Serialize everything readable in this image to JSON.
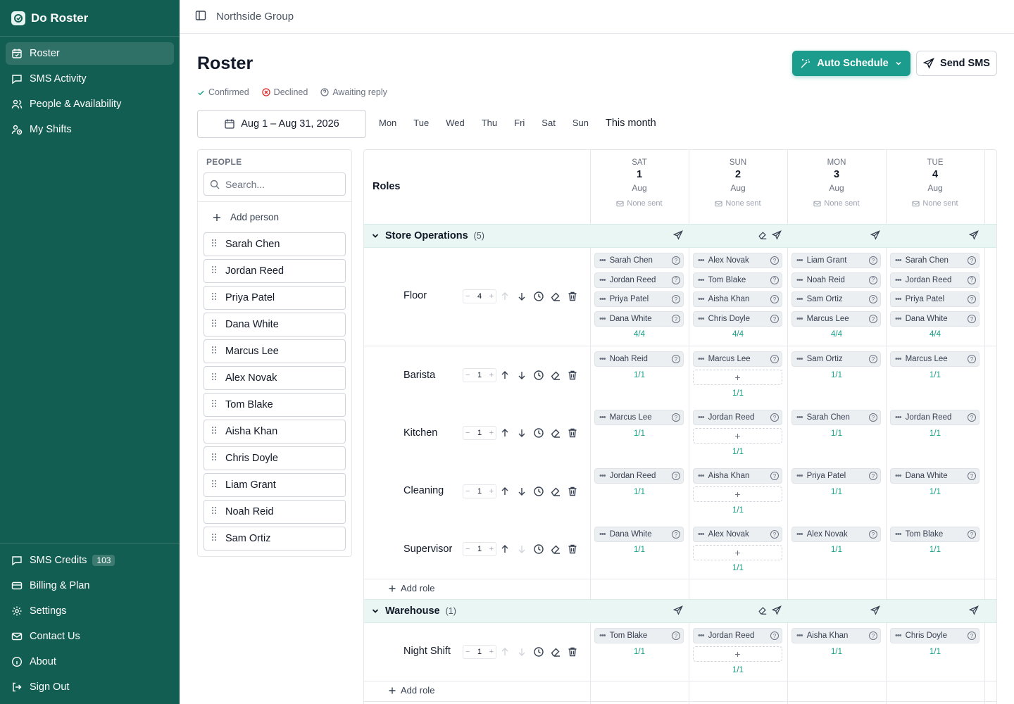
{
  "app": {
    "title": "Do Roster",
    "org": "Northside Group"
  },
  "sidebar": {
    "items": [
      {
        "label": "Roster",
        "icon": "calendar-check-icon",
        "active": true
      },
      {
        "label": "SMS Activity",
        "icon": "message-square-icon"
      },
      {
        "label": "People & Availability",
        "icon": "users-icon"
      },
      {
        "label": "My Shifts",
        "icon": "user-clock-icon"
      }
    ],
    "bottom": [
      {
        "label": "SMS Credits",
        "icon": "message-square-icon",
        "badge": "103"
      },
      {
        "label": "Billing & Plan",
        "icon": "credit-card-icon"
      },
      {
        "label": "Settings",
        "icon": "gear-icon"
      },
      {
        "label": "Contact Us",
        "icon": "mail-icon"
      },
      {
        "label": "About",
        "icon": "info-icon"
      },
      {
        "label": "Sign Out",
        "icon": "log-out-icon"
      }
    ]
  },
  "page": {
    "title": "Roster"
  },
  "legend": {
    "confirmed": "Confirmed",
    "declined": "Declined",
    "awaiting": "Awaiting reply"
  },
  "actions": {
    "auto_schedule": "Auto Schedule",
    "send_sms": "Send SMS"
  },
  "date_range": "Aug 1 – Aug 31, 2026",
  "weekdays": [
    "Mon",
    "Tue",
    "Wed",
    "Thu",
    "Fri",
    "Sat",
    "Sun"
  ],
  "this_month": "This month",
  "people": {
    "title": "PEOPLE",
    "search_placeholder": "Search...",
    "add_label": "Add person",
    "list": [
      "Sarah Chen",
      "Jordan Reed",
      "Priya Patel",
      "Dana White",
      "Marcus Lee",
      "Alex Novak",
      "Tom Blake",
      "Aisha Khan",
      "Chris Doyle",
      "Liam Grant",
      "Noah Reid",
      "Sam Ortiz"
    ]
  },
  "grid": {
    "roles_header": "Roles",
    "add_role": "Add role",
    "days": [
      {
        "dow": "SAT",
        "num": "1",
        "mon": "Aug",
        "sent": "None sent"
      },
      {
        "dow": "SUN",
        "num": "2",
        "mon": "Aug",
        "sent": "None sent"
      },
      {
        "dow": "MON",
        "num": "3",
        "mon": "Aug",
        "sent": "None sent"
      },
      {
        "dow": "TUE",
        "num": "4",
        "mon": "Aug",
        "sent": "None sent"
      }
    ],
    "groups": [
      {
        "name": "Store Operations",
        "count": "(5)",
        "roles": [
          {
            "name": "Floor",
            "qty": "4",
            "fills": [
              "4/4",
              "4/4",
              "4/4",
              "4/4"
            ],
            "cells": [
              [
                "Sarah Chen",
                "Jordan Reed",
                "Priya Patel",
                "Dana White"
              ],
              [
                "Alex Novak",
                "Tom Blake",
                "Aisha Khan",
                "Chris Doyle"
              ],
              [
                "Liam Grant",
                "Noah Reid",
                "Sam Ortiz",
                "Marcus Lee"
              ],
              [
                "Sarah Chen",
                "Jordan Reed",
                "Priya Patel",
                "Dana White"
              ]
            ]
          },
          {
            "name": "Barista",
            "qty": "1",
            "fills": [
              "1/1",
              "1/1",
              "1/1",
              "1/1"
            ],
            "cells": [
              [
                "Noah Reid"
              ],
              [
                "Marcus Lee"
              ],
              [
                "Sam Ortiz"
              ],
              [
                "Marcus Lee"
              ]
            ]
          },
          {
            "name": "Kitchen",
            "qty": "1",
            "fills": [
              "1/1",
              "1/1",
              "1/1",
              "1/1"
            ],
            "cells": [
              [
                "Marcus Lee"
              ],
              [
                "Jordan Reed"
              ],
              [
                "Sarah Chen"
              ],
              [
                "Jordan Reed"
              ]
            ]
          },
          {
            "name": "Cleaning",
            "qty": "1",
            "fills": [
              "1/1",
              "1/1",
              "1/1",
              "1/1"
            ],
            "cells": [
              [
                "Jordan Reed"
              ],
              [
                "Aisha Khan"
              ],
              [
                "Priya Patel"
              ],
              [
                "Dana White"
              ]
            ]
          },
          {
            "name": "Supervisor",
            "qty": "1",
            "fills": [
              "1/1",
              "1/1",
              "1/1",
              "1/1"
            ],
            "cells": [
              [
                "Dana White"
              ],
              [
                "Alex Novak"
              ],
              [
                "Alex Novak"
              ],
              [
                "Tom Blake"
              ]
            ]
          }
        ]
      },
      {
        "name": "Warehouse",
        "count": "(1)",
        "roles": [
          {
            "name": "Night Shift",
            "qty": "1",
            "fills": [
              "1/1",
              "1/1",
              "1/1",
              "1/1"
            ],
            "cells": [
              [
                "Tom Blake"
              ],
              [
                "Jordan Reed"
              ],
              [
                "Aisha Khan"
              ],
              [
                "Chris Doyle"
              ]
            ]
          }
        ]
      }
    ]
  },
  "colors": {
    "sidebar": "#135e52",
    "accent": "#1c9c8c",
    "group_bar": "#e9f6f4",
    "fill_text": "#16a085"
  }
}
